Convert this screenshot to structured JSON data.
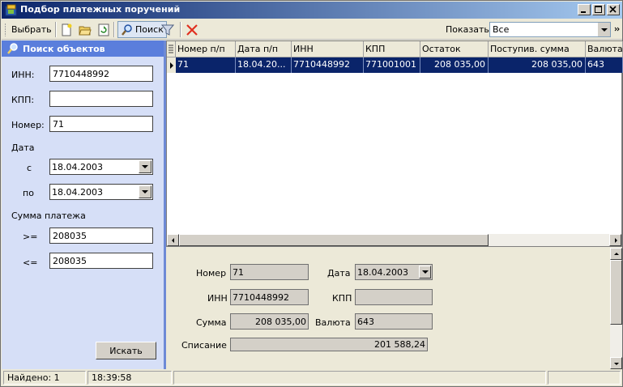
{
  "window": {
    "title": "Подбор платежных поручений",
    "controls": [
      "minimize",
      "maximize",
      "close"
    ]
  },
  "toolbar": {
    "select_label": "Выбрать",
    "search_label": "Поиск",
    "show_label": "Показать",
    "show_value": "Все"
  },
  "search_panel": {
    "title": "Поиск объектов",
    "inn_label": "ИНН:",
    "inn_value": "7710448992",
    "kpp_label": "КПП:",
    "kpp_value": "",
    "number_label": "Номер:",
    "number_value": "71",
    "date_label": "Дата",
    "date_from_label": "с",
    "date_from_value": "18.04.2003",
    "date_to_label": "по",
    "date_to_value": "18.04.2003",
    "amount_label": "Сумма платежа",
    "amount_ge_label": ">=",
    "amount_ge_value": "208035",
    "amount_le_label": "<=",
    "amount_le_value": "208035",
    "search_button": "Искать"
  },
  "grid": {
    "columns": [
      "Номер п/п",
      "Дата п/п",
      "ИНН",
      "КПП",
      "Остаток",
      "Поступив. сумма",
      "Валюта"
    ],
    "rows": [
      [
        "71",
        "18.04.20...",
        "7710448992",
        "771001001",
        "208 035,00",
        "208 035,00",
        "643"
      ]
    ]
  },
  "detail": {
    "number_label": "Номер",
    "number_value": "71",
    "date_label": "Дата",
    "date_value": "18.04.2003",
    "inn_label": "ИНН",
    "inn_value": "7710448992",
    "kpp_label": "КПП",
    "kpp_value": "",
    "sum_label": "Сумма",
    "sum_value": "208 035,00",
    "currency_label": "Валюта",
    "currency_value": "643",
    "writeoff_label": "Списание",
    "writeoff_value": "201 588,24"
  },
  "status": {
    "found": "Найдено: 1",
    "time": "18:39:58"
  }
}
